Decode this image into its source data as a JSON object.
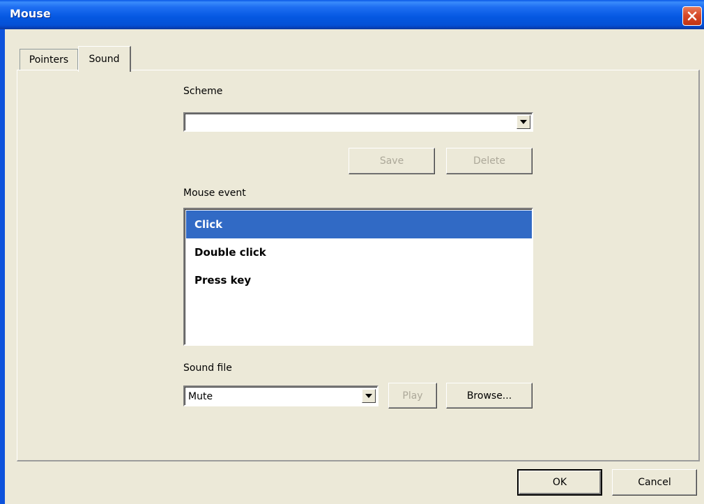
{
  "window": {
    "title": "Mouse"
  },
  "tabs": [
    {
      "label": "Pointers",
      "active": false
    },
    {
      "label": "Sound",
      "active": true
    }
  ],
  "scheme": {
    "label": "Scheme",
    "value": "",
    "save_label": "Save",
    "delete_label": "Delete"
  },
  "mouse_event": {
    "label": "Mouse event",
    "items": [
      "Click",
      "Double click",
      "Press key"
    ],
    "selected": "Click"
  },
  "sound_file": {
    "label": "Sound file",
    "value": "Mute",
    "play_label": "Play",
    "browse_label": "Browse..."
  },
  "footer": {
    "ok_label": "OK",
    "cancel_label": "Cancel"
  },
  "colors": {
    "titlebar": "#0558e2",
    "selection": "#316ac5",
    "face": "#ece9d8",
    "disabled_text": "#aca899"
  }
}
